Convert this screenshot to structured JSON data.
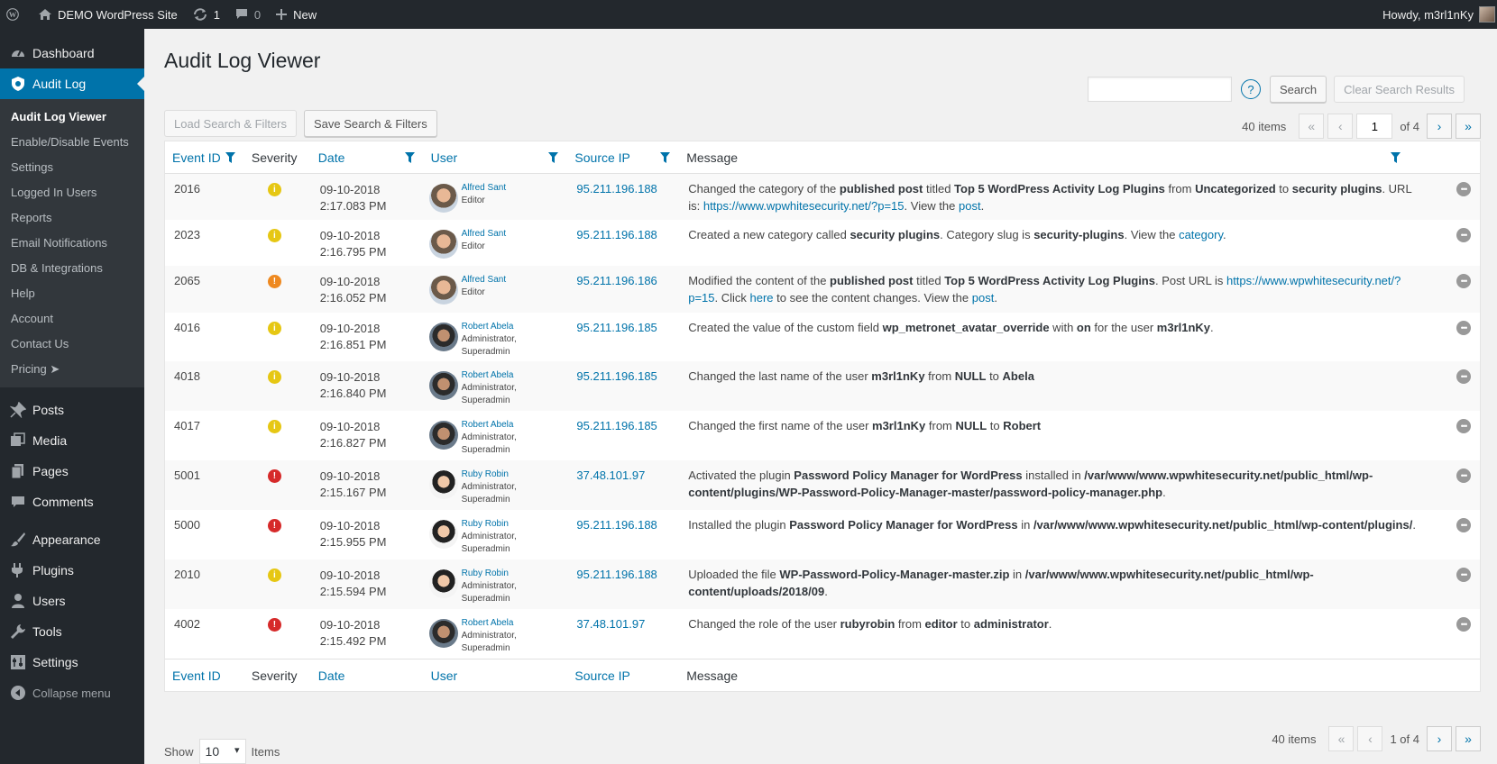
{
  "adminbar": {
    "site_name": "DEMO WordPress Site",
    "updates_count": "1",
    "comments_count": "0",
    "new_label": "New",
    "howdy": "Howdy, m3rl1nKy"
  },
  "sidebar": {
    "dashboard": "Dashboard",
    "audit_log": "Audit Log",
    "submenu": [
      "Audit Log Viewer",
      "Enable/Disable Events",
      "Settings",
      "Logged In Users",
      "Reports",
      "Email Notifications",
      "DB & Integrations",
      "Help",
      "Account",
      "Contact Us",
      "Pricing ➤"
    ],
    "menu": [
      "Posts",
      "Media",
      "Pages",
      "Comments",
      "Appearance",
      "Plugins",
      "Users",
      "Tools",
      "Settings"
    ],
    "collapse": "Collapse menu"
  },
  "page": {
    "title": "Audit Log Viewer",
    "search_placeholder": "",
    "help_glyph": "?",
    "search_button": "Search",
    "clear_button": "Clear Search Results",
    "load_button": "Load Search & Filters",
    "save_button": "Save Search & Filters",
    "items_count": "40 items",
    "page_current": "1",
    "page_of": "of 4",
    "page_of_bottom": "1 of 4",
    "show_label": "Show",
    "show_value": "10",
    "items_label": "Items"
  },
  "columns": {
    "event_id": "Event ID",
    "severity": "Severity",
    "date": "Date",
    "user": "User",
    "source_ip": "Source IP",
    "message": "Message"
  },
  "rows": [
    {
      "id": "2016",
      "severity": "warning",
      "sev_color": "#e6c713",
      "date": "09-10-2018",
      "time": "2:17.083 PM",
      "user": "Alfred Sant",
      "role1": "Editor",
      "role2": "",
      "avatar": "alfred",
      "ip": "95.211.196.188",
      "msg": [
        {
          "t": "Changed the category of the "
        },
        {
          "b": "published post"
        },
        {
          "t": " titled "
        },
        {
          "b": "Top 5 WordPress Activity Log Plugins"
        },
        {
          "t": " from "
        },
        {
          "b": "Uncategorized"
        },
        {
          "t": " to "
        },
        {
          "b": "security plugins"
        },
        {
          "t": ". URL is: "
        },
        {
          "a": "https://www.wpwhitesecurity.net/?p=15"
        },
        {
          "t": ". View the "
        },
        {
          "a": "post"
        },
        {
          "t": "."
        }
      ]
    },
    {
      "id": "2023",
      "severity": "warning",
      "sev_color": "#e6c713",
      "date": "09-10-2018",
      "time": "2:16.795 PM",
      "user": "Alfred Sant",
      "role1": "Editor",
      "role2": "",
      "avatar": "alfred",
      "ip": "95.211.196.188",
      "msg": [
        {
          "t": "Created a new category called "
        },
        {
          "b": "security plugins"
        },
        {
          "t": ". Category slug is "
        },
        {
          "b": "security-plugins"
        },
        {
          "t": ". View the "
        },
        {
          "a": "category"
        },
        {
          "t": "."
        }
      ]
    },
    {
      "id": "2065",
      "severity": "medium",
      "sev_color": "#ee8920",
      "date": "09-10-2018",
      "time": "2:16.052 PM",
      "user": "Alfred Sant",
      "role1": "Editor",
      "role2": "",
      "avatar": "alfred",
      "ip": "95.211.196.186",
      "msg": [
        {
          "t": "Modified the content of the "
        },
        {
          "b": "published post"
        },
        {
          "t": " titled "
        },
        {
          "b": "Top 5 WordPress Activity Log Plugins"
        },
        {
          "t": ". Post URL is "
        },
        {
          "a": "https://www.wpwhitesecurity.net/?p=15"
        },
        {
          "t": ". Click "
        },
        {
          "a": "here"
        },
        {
          "t": " to see the content changes. View the "
        },
        {
          "a": "post"
        },
        {
          "t": "."
        }
      ]
    },
    {
      "id": "4016",
      "severity": "warning",
      "sev_color": "#e6c713",
      "date": "09-10-2018",
      "time": "2:16.851 PM",
      "user": "Robert Abela",
      "role1": "Administrator,",
      "role2": "Superadmin",
      "avatar": "robert",
      "ip": "95.211.196.185",
      "msg": [
        {
          "t": "Created the value of the custom field "
        },
        {
          "b": "wp_metronet_avatar_override"
        },
        {
          "t": " with "
        },
        {
          "b": "on"
        },
        {
          "t": " for the user "
        },
        {
          "b": "m3rl1nKy"
        },
        {
          "t": "."
        }
      ]
    },
    {
      "id": "4018",
      "severity": "warning",
      "sev_color": "#e6c713",
      "date": "09-10-2018",
      "time": "2:16.840 PM",
      "user": "Robert Abela",
      "role1": "Administrator,",
      "role2": "Superadmin",
      "avatar": "robert",
      "ip": "95.211.196.185",
      "msg": [
        {
          "t": "Changed the last name of the user "
        },
        {
          "b": "m3rl1nKy"
        },
        {
          "t": " from "
        },
        {
          "b": "NULL"
        },
        {
          "t": " to "
        },
        {
          "b": "Abela"
        }
      ]
    },
    {
      "id": "4017",
      "severity": "warning",
      "sev_color": "#e6c713",
      "date": "09-10-2018",
      "time": "2:16.827 PM",
      "user": "Robert Abela",
      "role1": "Administrator,",
      "role2": "Superadmin",
      "avatar": "robert",
      "ip": "95.211.196.185",
      "msg": [
        {
          "t": "Changed the first name of the user "
        },
        {
          "b": "m3rl1nKy"
        },
        {
          "t": " from "
        },
        {
          "b": "NULL"
        },
        {
          "t": " to "
        },
        {
          "b": "Robert"
        }
      ]
    },
    {
      "id": "5001",
      "severity": "critical",
      "sev_color": "#d62a2a",
      "date": "09-10-2018",
      "time": "2:15.167 PM",
      "user": "Ruby Robin",
      "role1": "Administrator,",
      "role2": "Superadmin",
      "avatar": "ruby",
      "ip": "37.48.101.97",
      "msg": [
        {
          "t": "Activated the plugin "
        },
        {
          "b": "Password Policy Manager for WordPress"
        },
        {
          "t": " installed in "
        },
        {
          "b": "/var/www/www.wpwhitesecurity.net/public_html/wp-content/plugins/WP-Password-Policy-Manager-master/password-policy-manager.php"
        },
        {
          "t": "."
        }
      ]
    },
    {
      "id": "5000",
      "severity": "critical",
      "sev_color": "#d62a2a",
      "date": "09-10-2018",
      "time": "2:15.955 PM",
      "user": "Ruby Robin",
      "role1": "Administrator,",
      "role2": "Superadmin",
      "avatar": "ruby",
      "ip": "95.211.196.188",
      "msg": [
        {
          "t": "Installed the plugin "
        },
        {
          "b": "Password Policy Manager for WordPress"
        },
        {
          "t": " in "
        },
        {
          "b": "/var/www/www.wpwhitesecurity.net/public_html/wp-content/plugins/"
        },
        {
          "t": "."
        }
      ]
    },
    {
      "id": "2010",
      "severity": "warning",
      "sev_color": "#e6c713",
      "date": "09-10-2018",
      "time": "2:15.594 PM",
      "user": "Ruby Robin",
      "role1": "Administrator,",
      "role2": "Superadmin",
      "avatar": "ruby",
      "ip": "95.211.196.188",
      "msg": [
        {
          "t": "Uploaded the file "
        },
        {
          "b": "WP-Password-Policy-Manager-master.zip"
        },
        {
          "t": " in "
        },
        {
          "b": "/var/www/www.wpwhitesecurity.net/public_html/wp-content/uploads/2018/09"
        },
        {
          "t": "."
        }
      ]
    },
    {
      "id": "4002",
      "severity": "critical",
      "sev_color": "#d62a2a",
      "date": "09-10-2018",
      "time": "2:15.492 PM",
      "user": "Robert Abela",
      "role1": "Administrator,",
      "role2": "Superadmin",
      "avatar": "robert",
      "ip": "37.48.101.97",
      "msg": [
        {
          "t": "Changed the role of the user "
        },
        {
          "b": "rubyrobin"
        },
        {
          "t": " from "
        },
        {
          "b": "editor"
        },
        {
          "t": " to "
        },
        {
          "b": "administrator"
        },
        {
          "t": "."
        }
      ]
    }
  ],
  "colors": {
    "accent": "#0073aa",
    "adminbar_bg": "#23282d",
    "submenu_bg": "#32373c",
    "severity_warning": "#e6c713",
    "severity_medium": "#ee8920",
    "severity_critical": "#d62a2a"
  }
}
